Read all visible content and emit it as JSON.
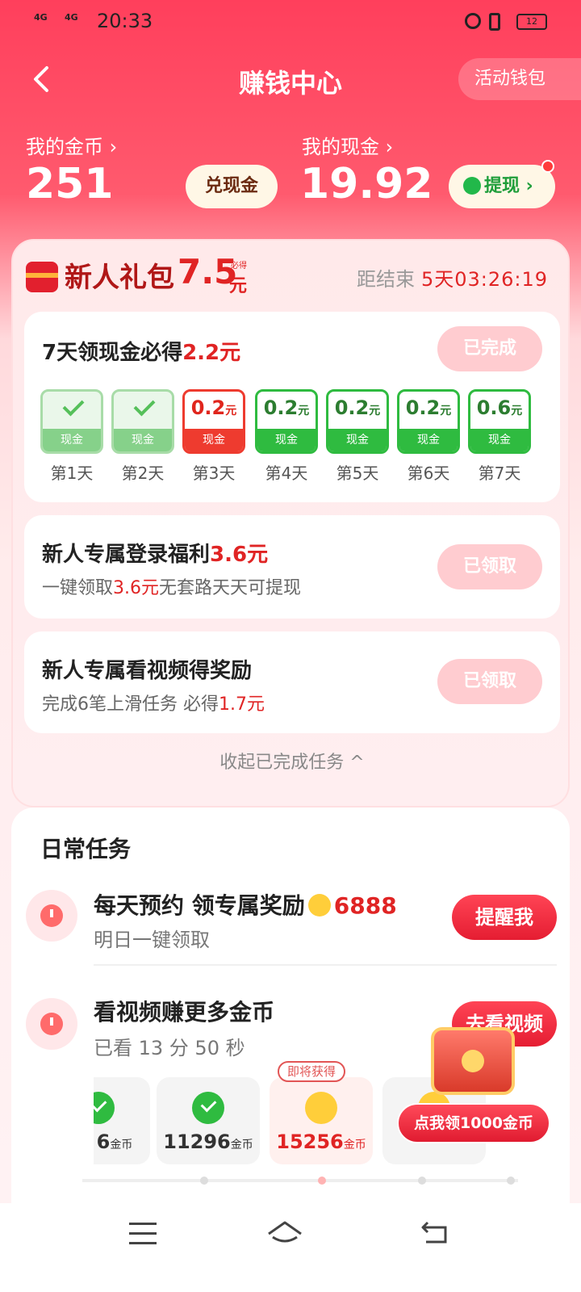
{
  "status_bar": {
    "signal1": "4G",
    "signal2": "4G",
    "time": "20:33",
    "battery": "12"
  },
  "header": {
    "title": "赚钱中心",
    "wallet_label": "活动钱包"
  },
  "balances": {
    "coins_label": "我的金币 ›",
    "coins_value": "251",
    "exchange_label": "兑现金",
    "cash_label": "我的现金 ›",
    "cash_value": "19.92",
    "withdraw_label": "提现 ›"
  },
  "newbie": {
    "title": "新人礼包",
    "amount": "7.5",
    "unit": "元",
    "sure": "必得",
    "countdown_label": "距结束",
    "countdown": "5天03:26:19",
    "seven_day": {
      "title_prefix": "7天领现金必得",
      "title_amount": "2.2元",
      "button": "已完成",
      "days": [
        {
          "label": "第1天",
          "amount": "",
          "tag": "现金",
          "state": "done"
        },
        {
          "label": "第2天",
          "amount": "",
          "tag": "现金",
          "state": "done"
        },
        {
          "label": "第3天",
          "amount": "0.2",
          "unit": "元",
          "tag": "现金",
          "state": "red"
        },
        {
          "label": "第4天",
          "amount": "0.2",
          "unit": "元",
          "tag": "现金",
          "state": "green"
        },
        {
          "label": "第5天",
          "amount": "0.2",
          "unit": "元",
          "tag": "现金",
          "state": "green"
        },
        {
          "label": "第6天",
          "amount": "0.2",
          "unit": "元",
          "tag": "现金",
          "state": "green"
        },
        {
          "label": "第7天",
          "amount": "0.6",
          "unit": "元",
          "tag": "现金",
          "state": "green"
        }
      ]
    },
    "login": {
      "title_prefix": "新人专属登录福利",
      "title_amount": "3.6元",
      "sub_prefix": "一键领取",
      "sub_amount": "3.6元",
      "sub_suffix": "无套路天天可提现",
      "button": "已领取"
    },
    "video": {
      "title": "新人专属看视频得奖励",
      "sub_prefix": "完成6笔上滑任务 必得",
      "sub_amount": "1.7元",
      "button": "已领取"
    },
    "collapse": "收起已完成任务 ^"
  },
  "daily": {
    "title": "日常任务",
    "reserve": {
      "title": "每天预约 领专属奖励",
      "amount": "6888",
      "sub": "明日一键领取",
      "button": "提醒我"
    },
    "watch": {
      "title": "看视频赚更多金币",
      "sub": "已看 13 分 50 秒",
      "button": "去看视频"
    },
    "milestones": [
      {
        "value": "6",
        "unit": "金币",
        "state": "done"
      },
      {
        "value": "11296",
        "unit": "金币",
        "state": "done"
      },
      {
        "value": "15256",
        "unit": "金币",
        "state": "active"
      }
    ],
    "soon_tag": "即将获得"
  },
  "promo": {
    "claim_label": "点我领1000金币"
  }
}
